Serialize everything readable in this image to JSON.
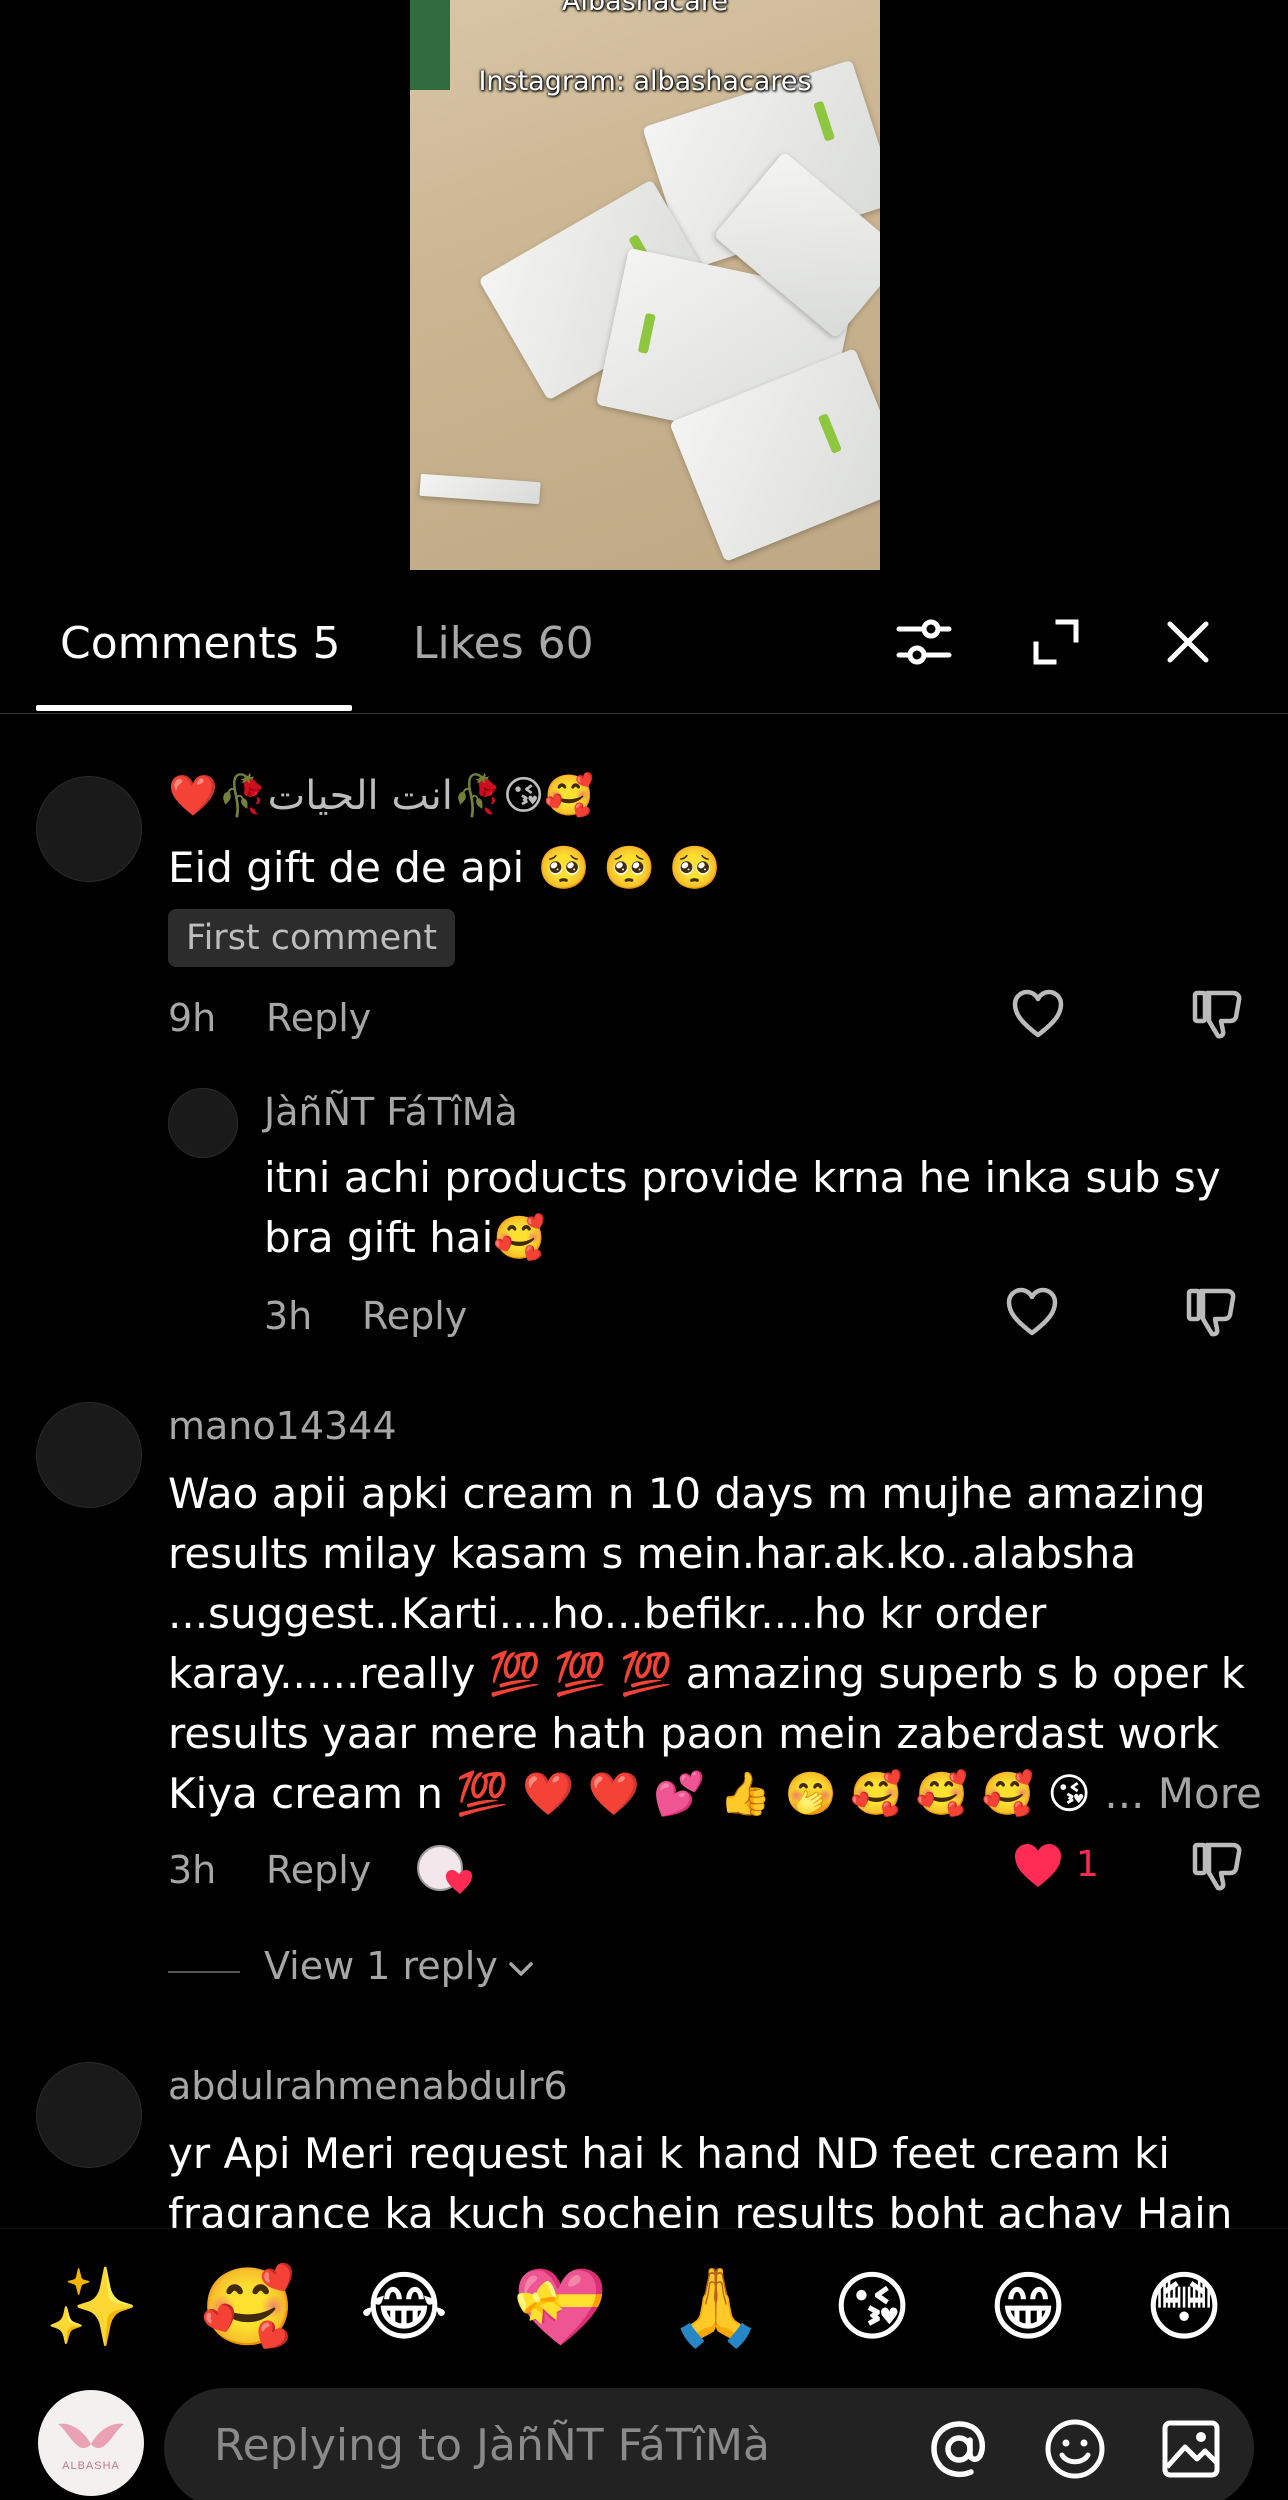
{
  "video": {
    "overlay_top": "Albashacare",
    "overlay_caption": "Instagram: albashacares"
  },
  "tabs": {
    "comments_label": "Comments 5",
    "likes_label": "Likes 60"
  },
  "comments": [
    {
      "username": "❤️🥀انت الحيات🥀😘🥰",
      "text": "Eid gift de de api 🥺 🥺 🥺",
      "badge": "First comment",
      "time": "9h",
      "reply_label": "Reply",
      "replies": [
        {
          "username": "JàñÑT FáTîMà",
          "text": "itni achi products provide krna he inka sub sy bra gift hai🥰",
          "time": "3h",
          "reply_label": "Reply"
        }
      ]
    },
    {
      "username": "mano14344",
      "text_lines": [
        "Wao apii apki cream n 10 days m mujhe amazing",
        "results milay kasam s mein.har.ak.ko..alabsha",
        "...suggest..Karti....ho...befikr....ho kr order",
        "karay......really 💯 💯 💯 amazing superb s b oper k",
        "results yaar mere hath paon mein zaberdast work",
        "Kiya cream n 💯 ❤️ ❤️ 💕 👍 🤭 🥰 🥰 🥰 😘"
      ],
      "more_label": "... More",
      "time": "3h",
      "reply_label": "Reply",
      "like_count": "1",
      "view_replies_label": "View 1 reply"
    },
    {
      "username": "abdulrahmenabdulr6",
      "text_lines": [
        "yr Api Meri request hai k hand ND feet cream ki",
        "fragrance ka kuch sochein results boht achay Hain"
      ]
    }
  ],
  "emoji_bar": [
    "✨",
    "🥰",
    "😂",
    "💝",
    "🙏",
    "😘",
    "😁",
    "😳"
  ],
  "input": {
    "placeholder": "Replying to JàñÑT FáTîMà",
    "user_avatar_text": "ALBASHA"
  },
  "colors": {
    "accent_like": "#fe2c55",
    "secondary_text": "#a6a6a6",
    "background": "#000000"
  }
}
